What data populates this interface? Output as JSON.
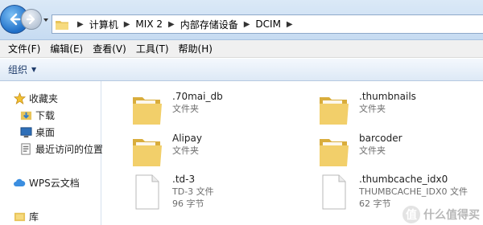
{
  "address": {
    "crumbs": [
      "计算机",
      "MIX 2",
      "内部存储设备",
      "DCIM"
    ]
  },
  "menu": {
    "items": [
      "文件(F)",
      "编辑(E)",
      "查看(V)",
      "工具(T)",
      "帮助(H)"
    ]
  },
  "toolbar": {
    "organize_label": "组织"
  },
  "nav": {
    "favorites": "收藏夹",
    "downloads": "下载",
    "desktop": "桌面",
    "recent": "最近访问的位置",
    "wps": "WPS云文档",
    "libraries": "库"
  },
  "files": [
    {
      "name": ".70mai_db",
      "type": "文件夹",
      "size": "",
      "icon": "folder-icon"
    },
    {
      "name": ".thumbnails",
      "type": "文件夹",
      "size": "",
      "icon": "folder-icon"
    },
    {
      "name": "Alipay",
      "type": "文件夹",
      "size": "",
      "icon": "folder-icon"
    },
    {
      "name": "barcoder",
      "type": "文件夹",
      "size": "",
      "icon": "folder-icon"
    },
    {
      "name": ".td-3",
      "type": "TD-3 文件",
      "size": "96 字节",
      "icon": "file-icon"
    },
    {
      "name": ".thumbcache_idx0",
      "type": "THUMBCACHE_IDX0 文件",
      "size": "62 字节",
      "icon": "file-icon"
    }
  ],
  "watermark": {
    "badge": "值",
    "text": "什么值得买"
  }
}
